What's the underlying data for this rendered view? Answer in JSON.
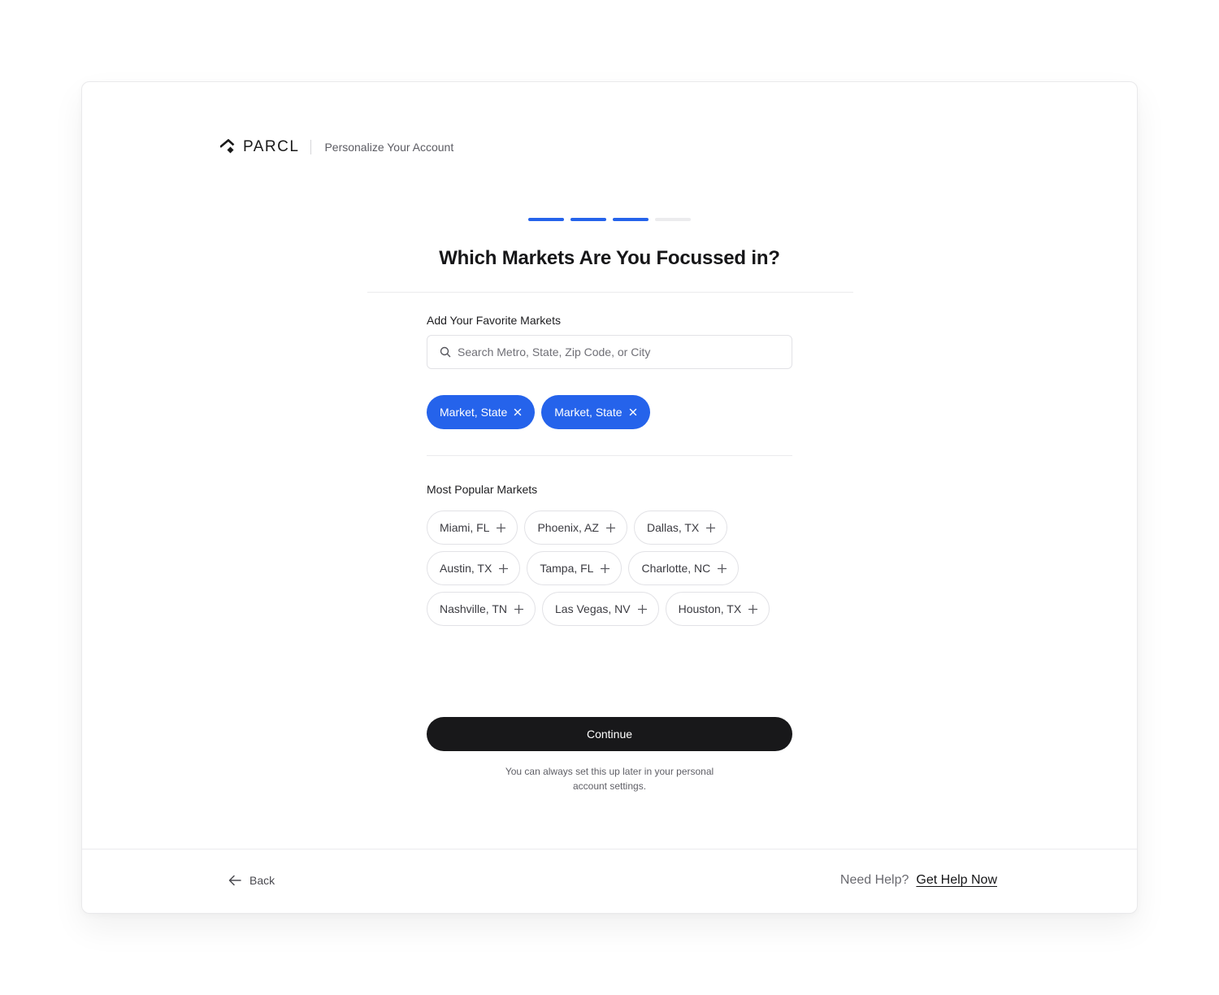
{
  "header": {
    "brand": "PARCL",
    "subtitle": "Personalize Your Account"
  },
  "progress": {
    "total_steps": 4,
    "completed_steps": 3
  },
  "title": "Which Markets Are You Focussed in?",
  "favorites": {
    "label": "Add Your Favorite Markets",
    "search_placeholder": "Search Metro, State, Zip Code, or City",
    "selected": [
      "Market, State",
      "Market, State"
    ]
  },
  "popular": {
    "label": "Most Popular Markets",
    "rows": [
      [
        "Miami, FL",
        "Phoenix, AZ",
        "Dallas, TX"
      ],
      [
        "Austin, TX",
        "Tampa, FL",
        "Charlotte, NC"
      ],
      [
        "Nashville, TN",
        "Las Vegas, NV",
        "Houston, TX"
      ]
    ]
  },
  "continue_label": "Continue",
  "hint": "You can always set this up later in your personal account settings.",
  "footer": {
    "back_label": "Back",
    "help_label": "Need Help?",
    "help_link": "Get Help Now"
  },
  "colors": {
    "accent": "#2563eb",
    "button_dark": "#18181a",
    "inactive_step": "#ececee"
  },
  "icons": {
    "logo": "parcl-logo-icon",
    "search": "search-icon",
    "remove": "close-icon",
    "add": "plus-icon",
    "back": "arrow-left-icon"
  }
}
